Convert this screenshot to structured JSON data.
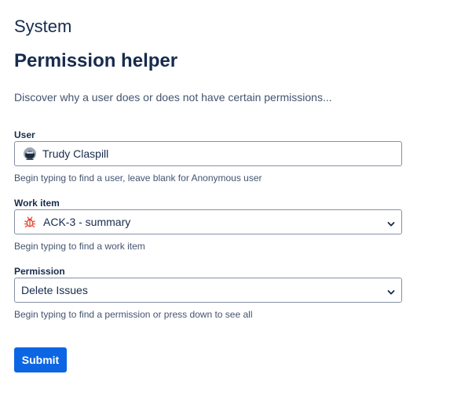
{
  "header": {
    "section_title": "System",
    "page_title": "Permission helper",
    "description": "Discover why a user does or does not have certain permissions..."
  },
  "form": {
    "user": {
      "label": "User",
      "value": "Trudy Claspill",
      "help": "Begin typing to find a user, leave blank for Anonymous user",
      "avatar_icon": "user-avatar"
    },
    "work_item": {
      "label": "Work item",
      "value": "ACK-3 - summary",
      "help": "Begin typing to find a work item",
      "icon": "bug-icon",
      "icon_color": "#e34935"
    },
    "permission": {
      "label": "Permission",
      "value": "Delete Issues",
      "help": "Begin typing to find a permission or press down to see all"
    },
    "submit_label": "Submit"
  },
  "colors": {
    "primary_button": "#0c66e4",
    "text": "#172b4d",
    "subtle_text": "#44546f",
    "border": "#8590a2"
  }
}
